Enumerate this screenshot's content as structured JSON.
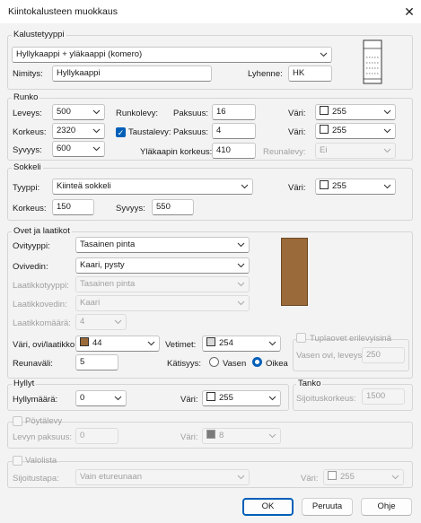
{
  "window": {
    "title": "Kiintokalusteen muokkaus"
  },
  "colors": {
    "accent": "#005fb8",
    "door_color": "#9b6a3a",
    "drawer_color": "#9b6a3a",
    "handle_color": "#d9d9d9",
    "white": "#ffffff",
    "dark_gray": "#7a7a7a"
  },
  "type_section": {
    "label": "Kalustetyyppi",
    "type_value": "Hyllykaappi + yläkaappi (komero)",
    "name_label": "Nimitys:",
    "name_value": "Hyllykaappi",
    "abbr_label": "Lyhenne:",
    "abbr_value": "HK"
  },
  "body_section": {
    "label": "Runko",
    "width_label": "Leveys:",
    "width_value": "500",
    "height_label": "Korkeus:",
    "height_value": "2320",
    "depth_label": "Syvyys:",
    "depth_value": "600",
    "frame_board_label": "Runkolevy:",
    "thickness_label": "Paksuus:",
    "frame_thickness": "16",
    "back_board_label": "Taustalevy:",
    "back_thickness": "4",
    "top_height_label": "Yläkaapin korkeus:",
    "top_height_value": "410",
    "color_label": "Väri:",
    "frame_color": "255",
    "back_color_label": "Väri:",
    "back_color": "255",
    "edge_label": "Reunalevy:",
    "edge_value": "Ei"
  },
  "plinth_section": {
    "label": "Sokkeli",
    "type_label": "Tyyppi:",
    "type_value": "Kiinteä sokkeli",
    "color_label": "Väri:",
    "color_value": "255",
    "height_label": "Korkeus:",
    "height_value": "150",
    "depth_label": "Syvyys:",
    "depth_value": "550"
  },
  "doors_section": {
    "label": "Ovet ja laatikot",
    "door_type_label": "Ovityyppi:",
    "door_type_value": "Tasainen pinta",
    "door_handle_label": "Ovivedin:",
    "door_handle_value": "Kaari, pysty",
    "drawer_type_label": "Laatikkotyyppi:",
    "drawer_type_value": "Tasainen pinta",
    "drawer_handle_label": "Laatikkovedin:",
    "drawer_handle_value": "Kaari",
    "drawer_count_label": "Laatikkomäärä:",
    "drawer_count_value": "4",
    "color_label": "Väri, ovi/laatikko:",
    "color_value": "44",
    "handles_label": "Vetimet:",
    "handles_value": "254",
    "gap_label": "Reunaväli:",
    "gap_value": "5",
    "handedness_label": "Kätisyys:",
    "left_label": "Vasen",
    "right_label": "Oikea",
    "double_label": "Tuplaovet erilevyisinä",
    "left_width_label": "Vasen ovi, leveys:",
    "left_width_value": "250"
  },
  "shelves_section": {
    "label": "Hyllyt",
    "count_label": "Hyllymäärä:",
    "count_value": "0",
    "color_label": "Väri:",
    "color_value": "255"
  },
  "pole_section": {
    "label": "Tanko",
    "height_label": "Sijoituskorkeus:",
    "height_value": "1500"
  },
  "table_section": {
    "label": "Pöytälevy",
    "thickness_label": "Levyn paksuus:",
    "thickness_value": "0",
    "color_label": "Väri:",
    "color_value": "8"
  },
  "light_section": {
    "label": "Valolista",
    "placement_label": "Sijoitustapa:",
    "placement_value": "Vain etureunaan",
    "color_label": "Väri:",
    "color_value": "255"
  },
  "buttons": {
    "ok": "OK",
    "cancel": "Peruuta",
    "help": "Ohje"
  }
}
